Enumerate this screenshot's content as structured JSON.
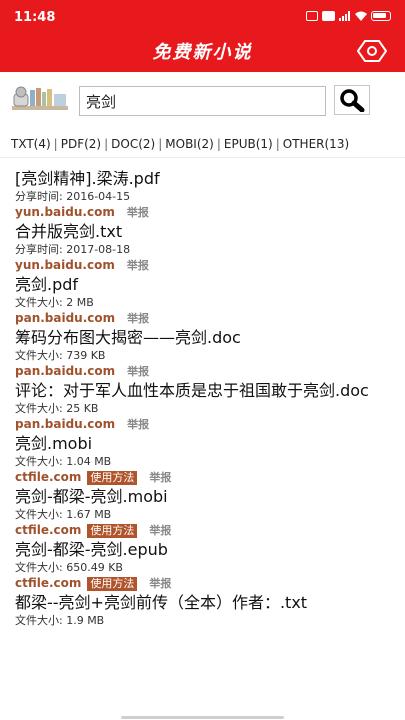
{
  "status": {
    "time": "11:48",
    "hd_label": "HD",
    "battery": "90"
  },
  "app": {
    "title": "免费新小说"
  },
  "search": {
    "value": "亮剑"
  },
  "filters": [
    "TXT(4)",
    "PDF(2)",
    "DOC(2)",
    "MOBI(2)",
    "EPUB(1)",
    "OTHER(13)"
  ],
  "results": [
    {
      "title": "[亮剑精神].梁涛.pdf",
      "meta": "分享时间: 2016-04-15",
      "domain": "yun.baidu.com",
      "how": "",
      "report": "举报"
    },
    {
      "title": "合并版亮剑.txt",
      "meta": "分享时间: 2017-08-18",
      "domain": "yun.baidu.com",
      "how": "",
      "report": "举报"
    },
    {
      "title": "亮剑.pdf",
      "meta": "文件大小: 2 MB",
      "domain": "pan.baidu.com",
      "how": "",
      "report": "举报"
    },
    {
      "title": "筹码分布图大揭密——亮剑.doc",
      "meta": "文件大小: 739 KB",
      "domain": "pan.baidu.com",
      "how": "",
      "report": "举报"
    },
    {
      "title": "评论：对于军人血性本质是忠于祖国敢于亮剑.doc",
      "meta": "文件大小: 25 KB",
      "domain": "pan.baidu.com",
      "how": "",
      "report": "举报"
    },
    {
      "title": "亮剑.mobi",
      "meta": "文件大小: 1.04 MB",
      "domain": "ctfile.com",
      "how": "使用方法",
      "report": "举报"
    },
    {
      "title": "亮剑-都梁-亮剑.mobi",
      "meta": "文件大小: 1.67 MB",
      "domain": "ctfile.com",
      "how": "使用方法",
      "report": "举报"
    },
    {
      "title": "亮剑-都梁-亮剑.epub",
      "meta": "文件大小: 650.49 KB",
      "domain": "ctfile.com",
      "how": "使用方法",
      "report": "举报"
    },
    {
      "title": "都梁--亮剑+亮剑前传（全本）作者：.txt",
      "meta": "文件大小: 1.9 MB",
      "domain": "",
      "how": "",
      "report": ""
    }
  ]
}
